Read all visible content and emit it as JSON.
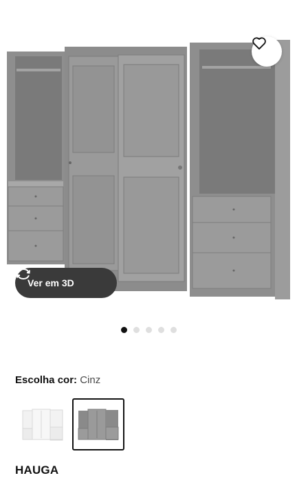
{
  "product": {
    "name": "HAUGA"
  },
  "actions": {
    "view_3d_label": "Ver em 3D"
  },
  "icons": {
    "favorite": "heart-outline-icon",
    "rotate_3d": "rotate-arrows-icon"
  },
  "gallery": {
    "total_images": 5,
    "active_index": 0
  },
  "color_selector": {
    "label": "Escolha cor:",
    "selected_value": "Cinz",
    "swatches": [
      {
        "variant": "white",
        "selected": false
      },
      {
        "variant": "grey",
        "selected": true
      }
    ]
  },
  "colors": {
    "accent_dark": "#111111",
    "button_bg": "#3a3a3a",
    "wardrobe_grey": "#8f8f8f"
  }
}
